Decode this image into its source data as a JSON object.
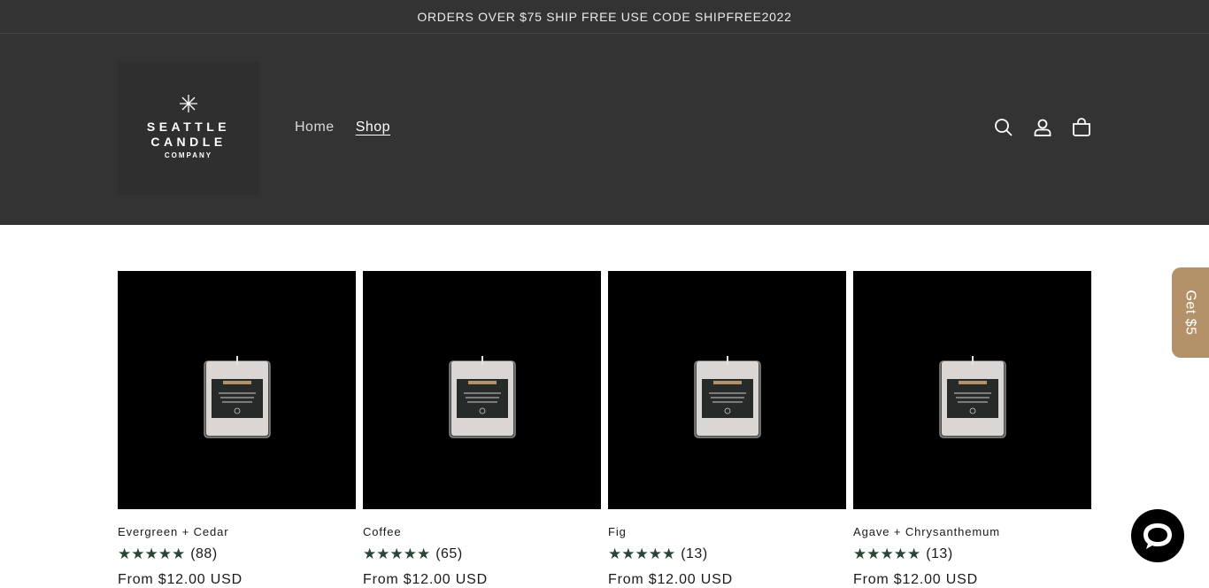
{
  "announcement": "ORDERS OVER $75 SHIP FREE USE CODE SHIPFREE2022",
  "logo": {
    "line1": "SEATTLE",
    "line2": "CANDLE",
    "line3": "COMPANY"
  },
  "nav": [
    {
      "label": "Home",
      "active": false
    },
    {
      "label": "Shop",
      "active": true
    }
  ],
  "header_icons": [
    "search-icon",
    "account-icon",
    "cart-icon"
  ],
  "products": [
    {
      "title": "Evergreen + Cedar",
      "rating": "★★★★★",
      "count": "(88)",
      "price": "From $12.00 USD"
    },
    {
      "title": "Coffee",
      "rating": "★★★★★",
      "count": "(65)",
      "price": "From $12.00 USD"
    },
    {
      "title": "Fig",
      "rating": "★★★★★",
      "count": "(13)",
      "price": "From $12.00 USD"
    },
    {
      "title": "Agave + Chrysanthemum",
      "rating": "★★★★★",
      "count": "(13)",
      "price": "From $12.00 USD"
    }
  ],
  "promo_tab": "Get $5",
  "colors": {
    "header_bg": "#333333",
    "star": "#2a4535",
    "promo": "#b3926a"
  }
}
